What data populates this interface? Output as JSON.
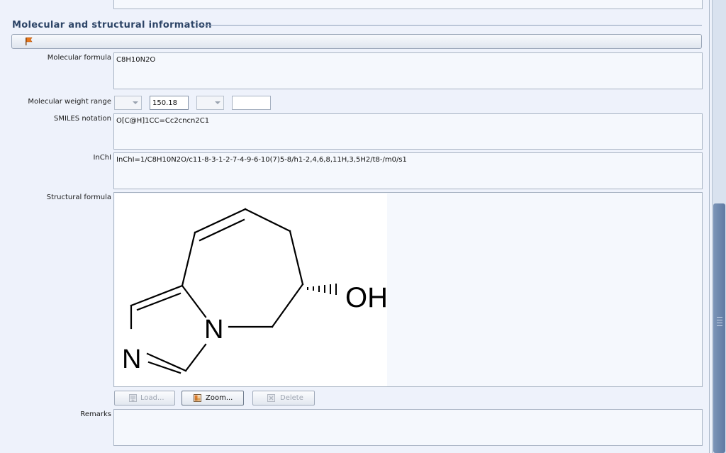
{
  "section": {
    "title": "Molecular and structural information",
    "flag_icon": "flag-icon"
  },
  "fields": {
    "formula_label": "Molecular formula",
    "formula_value": "C8H10N2O",
    "weight_label": "Molecular weight range",
    "weight_value": "150.18",
    "smiles_label": "SMILES notation",
    "smiles_value": "O[C@H]1CC=Cc2cncn2C1",
    "inchi_label": "InChI",
    "inchi_value": "InChI=1/C8H10N2O/c11-8-3-1-2-7-4-9-6-10(7)5-8/h1-2,4,6,8,11H,3,5H2/t8-/m0/s1",
    "structure_label": "Structural formula",
    "remarks_label": "Remarks",
    "remarks_value": ""
  },
  "structure": {
    "oh_label": "OH",
    "n1_label": "N",
    "n2_label": "N"
  },
  "buttons": {
    "load": "Load...",
    "zoom": "Zoom...",
    "delete": "Delete"
  },
  "colors": {
    "background": "#eef2fb",
    "title": "#2c4466",
    "scroll_thumb": "#6d87ad"
  }
}
